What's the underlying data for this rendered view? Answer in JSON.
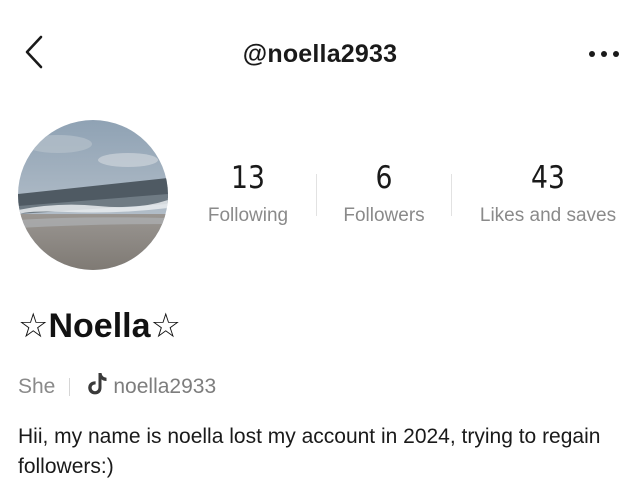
{
  "header": {
    "username": "@noella2933",
    "back_icon": "chevron-left-icon",
    "more_icon": "ellipsis-icon"
  },
  "profile": {
    "avatar_icon": "beach-photo",
    "display_name": "☆Noella☆",
    "pronoun": "She",
    "tiktok_handle": "noella2933",
    "tiktok_icon": "tiktok-icon",
    "bio": "Hii, my name is noella lost my account in 2024, trying to regain followers:)"
  },
  "stats": [
    {
      "value": "13",
      "label": "Following"
    },
    {
      "value": "6",
      "label": "Followers"
    },
    {
      "value": "43",
      "label": "Likes and saves"
    }
  ],
  "colors": {
    "text": "#1a1a1a",
    "muted": "#8a8a8a",
    "divider": "#e2e2e2",
    "background": "#ffffff"
  }
}
